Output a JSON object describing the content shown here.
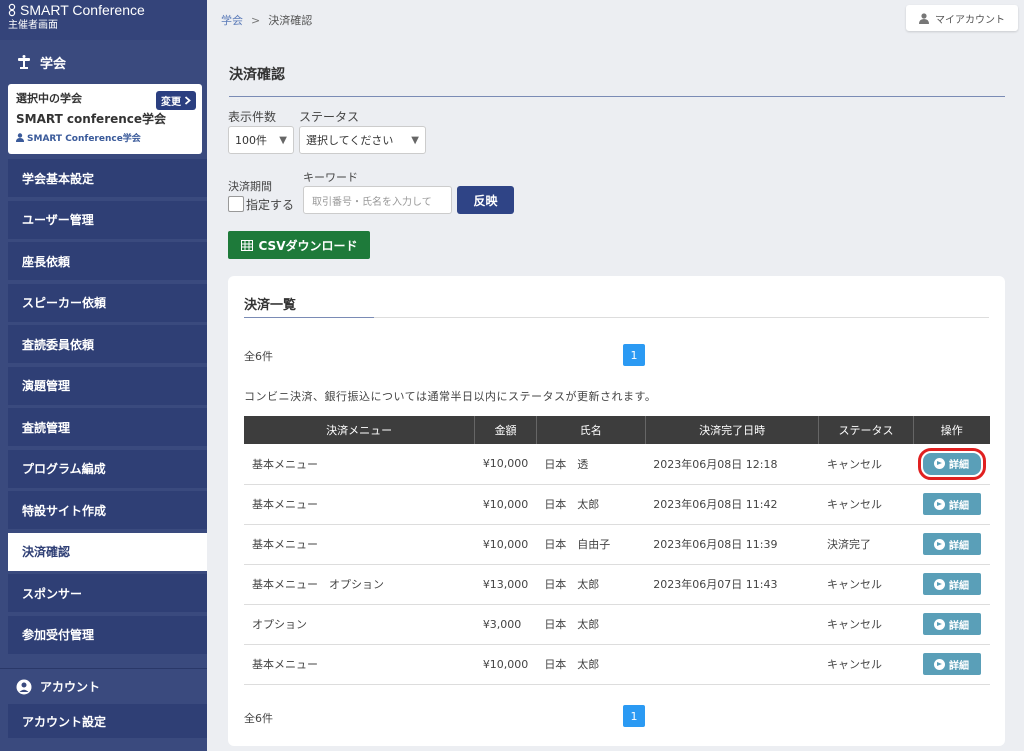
{
  "sidebar": {
    "brand_title": "SMART Conference",
    "brand_sub": "主催者画面",
    "section_society": "学会",
    "society_card": {
      "label": "選択中の学会",
      "change_label": "変更",
      "name": "SMART conference学会",
      "user": "SMART Conference学会"
    },
    "items": [
      {
        "label": "学会基本設定"
      },
      {
        "label": "ユーザー管理"
      },
      {
        "label": "座長依頼"
      },
      {
        "label": "スピーカー依頼"
      },
      {
        "label": "査読委員依頼"
      },
      {
        "label": "演題管理"
      },
      {
        "label": "査読管理"
      },
      {
        "label": "プログラム編成"
      },
      {
        "label": "特設サイト作成"
      },
      {
        "label": "決済確認"
      },
      {
        "label": "スポンサー"
      },
      {
        "label": "参加受付管理"
      }
    ],
    "active_item": "決済確認",
    "section_account": "アカウント",
    "account_item": "アカウント設定"
  },
  "topbar": {
    "breadcrumb_link": "学会",
    "breadcrumb_sep": ">",
    "breadcrumb_current": "決済確認",
    "account_label": "マイアカウント"
  },
  "main": {
    "title": "決済確認",
    "filters": {
      "count_label": "表示件数",
      "count_value": "100件",
      "status_label": "ステータス",
      "status_value": "選択してください",
      "period_label": "決済期間",
      "period_check_label": "指定する",
      "keyword_label": "キーワード",
      "keyword_placeholder": "取引番号・氏名を入力して",
      "reflect_label": "反映"
    },
    "csv_label": "CSVダウンロード",
    "card": {
      "title": "決済一覧",
      "total": "全6件",
      "page": "1",
      "notice": "コンビニ決済、銀行振込については通常半日以内にステータスが更新されます。",
      "columns": [
        "決済メニュー",
        "金額",
        "氏名",
        "決済完了日時",
        "ステータス",
        "操作"
      ],
      "detail_label": "詳細",
      "rows": [
        {
          "menu": "基本メニュー",
          "amount": "¥10,000",
          "name": "日本　透",
          "date": "2023年06月08日 12:18",
          "status": "キャンセル"
        },
        {
          "menu": "基本メニュー",
          "amount": "¥10,000",
          "name": "日本　太郎",
          "date": "2023年06月08日 11:42",
          "status": "キャンセル"
        },
        {
          "menu": "基本メニュー",
          "amount": "¥10,000",
          "name": "日本　自由子",
          "date": "2023年06月08日 11:39",
          "status": "決済完了"
        },
        {
          "menu": "基本メニュー　オプション",
          "amount": "¥13,000",
          "name": "日本　太郎",
          "date": "2023年06月07日 11:43",
          "status": "キャンセル"
        },
        {
          "menu": "オプション",
          "amount": "¥3,000",
          "name": "日本　太郎",
          "date": "",
          "status": "キャンセル"
        },
        {
          "menu": "基本メニュー",
          "amount": "¥10,000",
          "name": "日本　太郎",
          "date": "",
          "status": "キャンセル"
        }
      ]
    }
  },
  "colors": {
    "sidebar": "#3a4a7e",
    "menu_item": "#2f3f75",
    "primary_button": "#2f4486",
    "csv_button": "#1e7a3a",
    "detail_button": "#5a9fb8",
    "highlight": "#e02020"
  }
}
